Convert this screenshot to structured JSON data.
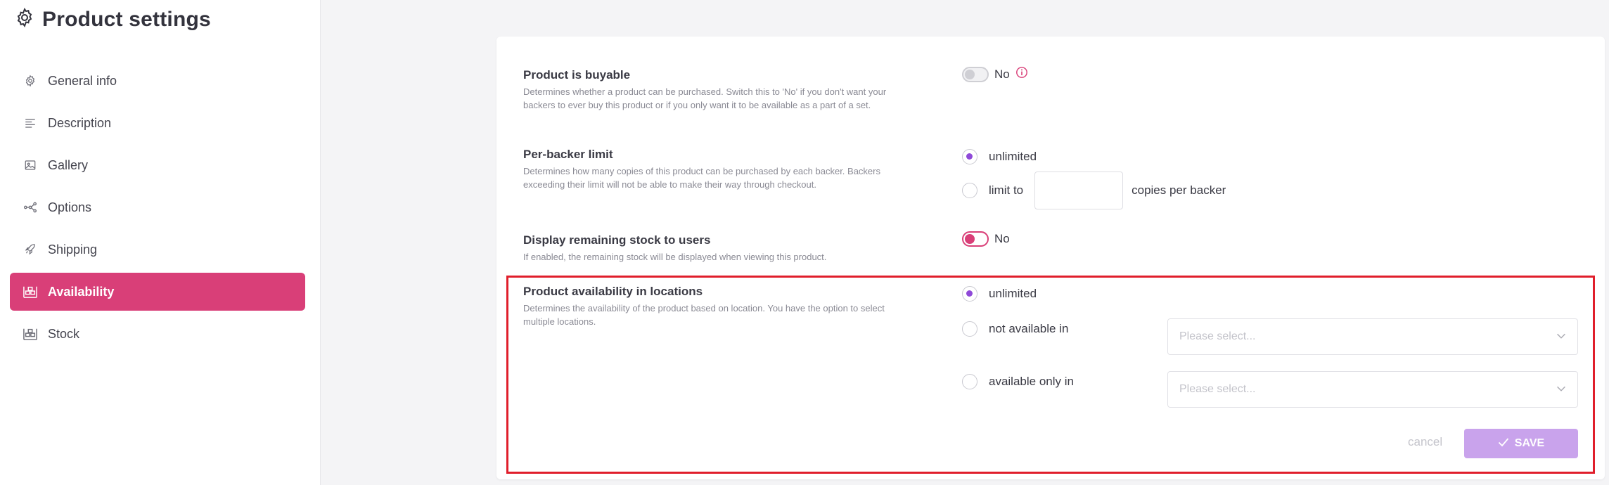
{
  "sidebar": {
    "title": "Product settings",
    "items": [
      {
        "label": "General info",
        "icon": "gear-icon"
      },
      {
        "label": "Description",
        "icon": "text-lines-icon"
      },
      {
        "label": "Gallery",
        "icon": "image-icon"
      },
      {
        "label": "Options",
        "icon": "nodes-icon"
      },
      {
        "label": "Shipping",
        "icon": "rocket-icon"
      },
      {
        "label": "Availability",
        "icon": "warehouse-icon",
        "active": true
      },
      {
        "label": "Stock",
        "icon": "warehouse-icon"
      }
    ]
  },
  "settings": {
    "buyable": {
      "label": "Product is buyable",
      "description": "Determines whether a product can be purchased. Switch this to 'No' if you don't want your backers to ever buy this product or if you only want it to be available as a part of a set.",
      "value_label": "No",
      "toggle_on": false
    },
    "per_backer": {
      "label": "Per-backer limit",
      "description": "Determines how many copies of this product can be purchased by each backer. Backers exceeding their limit will not be able to make their way through checkout.",
      "option_unlimited": "unlimited",
      "option_limit": "limit to",
      "limit_suffix": "copies per backer",
      "limit_value": ""
    },
    "display_stock": {
      "label": "Display remaining stock to users",
      "description": "If enabled, the remaining stock will be displayed when viewing this product.",
      "value_label": "No"
    },
    "locations": {
      "label": "Product availability in locations",
      "description": "Determines the availability of the product based on location. You have the option to select multiple locations.",
      "option_unlimited": "unlimited",
      "option_not_available": "not available in",
      "option_available_only": "available only in",
      "select_placeholder": "Please select..."
    }
  },
  "actions": {
    "cancel": "cancel",
    "save": "SAVE"
  },
  "colors": {
    "accent_pink": "#d93f78",
    "radio_purple": "#8f49d8",
    "save_bg": "#c9a3ec",
    "highlight_red": "#e01e2b"
  }
}
